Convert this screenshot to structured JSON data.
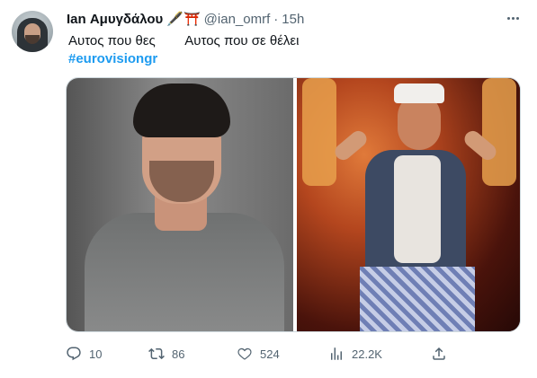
{
  "tweet": {
    "author_name": "Ian Αμυγδάλου",
    "author_emojis": [
      "🖋️",
      "⛩️"
    ],
    "handle": "@ian_omrf",
    "separator": "·",
    "time": "15h",
    "text": "Αυτος που θες        Αυτος που σε θέλει",
    "hashtag": "#eurovisiongr",
    "media": {
      "left_image": "portrait-photo",
      "right_image": "performer-photo"
    },
    "actions": {
      "replies": "10",
      "retweets": "86",
      "likes": "524",
      "views": "22.2K"
    }
  },
  "icons": {
    "more": "more-icon",
    "reply": "reply-icon",
    "retweet": "retweet-icon",
    "like": "heart-icon",
    "views": "views-icon",
    "share": "share-icon"
  },
  "colors": {
    "text": "#0f1419",
    "secondary": "#536471",
    "accent": "#1d9bf0",
    "border": "#cfd9de"
  }
}
